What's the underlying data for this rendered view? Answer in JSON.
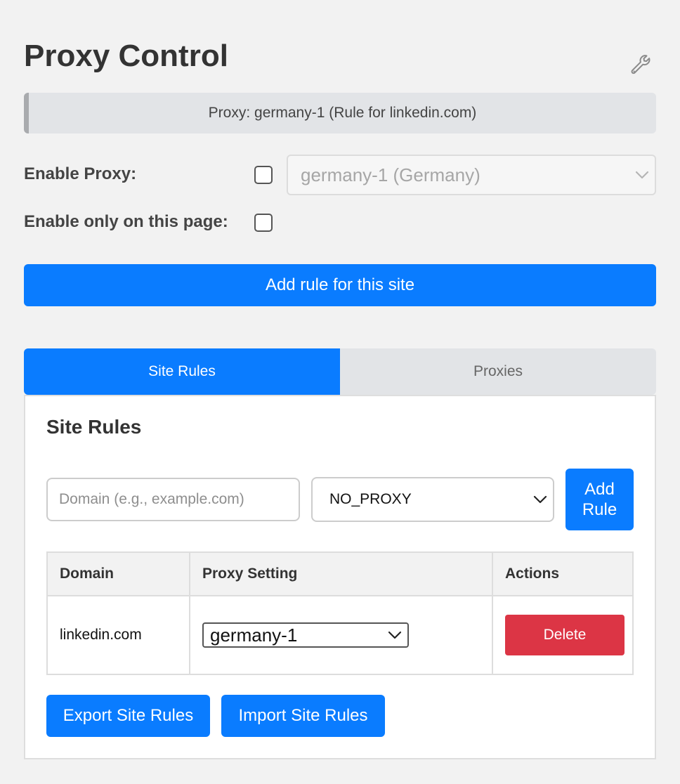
{
  "header": {
    "title": "Proxy Control",
    "settings_icon": "wrench-icon"
  },
  "status": {
    "text": "Proxy: germany-1 (Rule for linkedin.com)"
  },
  "form": {
    "enable_proxy_label": "Enable Proxy:",
    "enable_proxy_checked": false,
    "enable_page_label": "Enable only on this page:",
    "enable_page_checked": false,
    "proxy_select_value": "germany-1 (Germany)"
  },
  "actions": {
    "add_rule_site_label": "Add rule for this site"
  },
  "tabs": [
    {
      "label": "Site Rules",
      "active": true
    },
    {
      "label": "Proxies",
      "active": false
    }
  ],
  "site_rules": {
    "title": "Site Rules",
    "domain_input": {
      "placeholder": "Domain (e.g., example.com)",
      "value": ""
    },
    "proxy_select_value": "NO_PROXY",
    "add_rule_label": "Add Rule",
    "table": {
      "headers": [
        "Domain",
        "Proxy Setting",
        "Actions"
      ],
      "rows": [
        {
          "domain": "linkedin.com",
          "proxy": "germany-1",
          "action": "Delete"
        }
      ]
    },
    "export_label": "Export Site Rules",
    "import_label": "Import Site Rules"
  },
  "colors": {
    "accent": "#0a7cff",
    "danger": "#dc3545",
    "background": "#f2f2f2"
  }
}
